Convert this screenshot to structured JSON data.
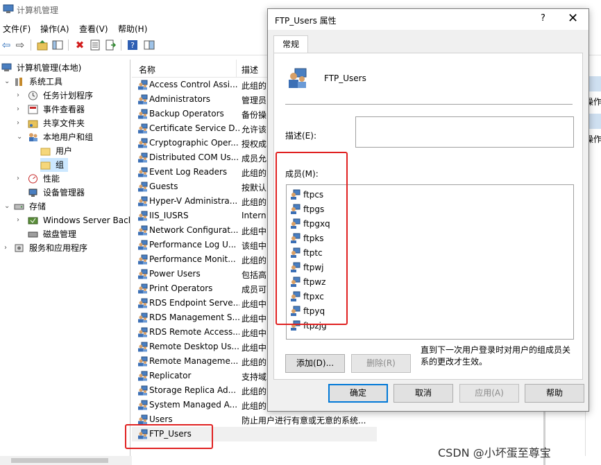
{
  "window": {
    "title": "计算机管理"
  },
  "menu": [
    "文件(F)",
    "操作(A)",
    "查看(V)",
    "帮助(H)"
  ],
  "toolbar": {
    "back_icon": "back-arrow-icon",
    "forward_icon": "forward-arrow-icon",
    "up_icon": "up-folder-icon",
    "show_tree_icon": "show-tree-icon",
    "delete_icon": "delete-icon",
    "properties_icon": "properties-icon",
    "export_icon": "export-icon",
    "help_icon": "help-icon",
    "view_icon": "view-pane-icon"
  },
  "tree": [
    {
      "label": "计算机管理(本地)"
    },
    {
      "label": "系统工具"
    },
    {
      "label": "任务计划程序"
    },
    {
      "label": "事件查看器"
    },
    {
      "label": "共享文件夹"
    },
    {
      "label": "本地用户和组"
    },
    {
      "label": "用户"
    },
    {
      "label": "组"
    },
    {
      "label": "性能"
    },
    {
      "label": "设备管理器"
    },
    {
      "label": "存储"
    },
    {
      "label": "Windows Server Back"
    },
    {
      "label": "磁盘管理"
    },
    {
      "label": "服务和应用程序"
    }
  ],
  "list": {
    "col_name": "名称",
    "col_desc": "描述",
    "rows": [
      {
        "name": "Access Control Assi...",
        "desc": "此组的"
      },
      {
        "name": "Administrators",
        "desc": "管理员"
      },
      {
        "name": "Backup Operators",
        "desc": "备份操"
      },
      {
        "name": "Certificate Service D...",
        "desc": "允许该"
      },
      {
        "name": "Cryptographic Oper...",
        "desc": "授权成"
      },
      {
        "name": "Distributed COM Us...",
        "desc": "成员允"
      },
      {
        "name": "Event Log Readers",
        "desc": "此组的"
      },
      {
        "name": "Guests",
        "desc": "按默认"
      },
      {
        "name": "Hyper-V Administra...",
        "desc": "此组的"
      },
      {
        "name": "IIS_IUSRS",
        "desc": "Intern"
      },
      {
        "name": "Network Configurat...",
        "desc": "此组中"
      },
      {
        "name": "Performance Log U...",
        "desc": "该组中"
      },
      {
        "name": "Performance Monit...",
        "desc": "此组的"
      },
      {
        "name": "Power Users",
        "desc": "包括高"
      },
      {
        "name": "Print Operators",
        "desc": "成员可"
      },
      {
        "name": "RDS Endpoint Serve...",
        "desc": "此组中"
      },
      {
        "name": "RDS Management S...",
        "desc": "此组中"
      },
      {
        "name": "RDS Remote Access...",
        "desc": "此组中"
      },
      {
        "name": "Remote Desktop Us...",
        "desc": "此组中"
      },
      {
        "name": "Remote Manageme...",
        "desc": "此组的"
      },
      {
        "name": "Replicator",
        "desc": "支持域"
      },
      {
        "name": "Storage Replica Ad...",
        "desc": "此组的"
      },
      {
        "name": "System Managed A...",
        "desc": "此组的"
      },
      {
        "name": "Users",
        "desc": "防止用户进行有意或无意的系统..."
      },
      {
        "name": "FTP_Users",
        "desc": ""
      }
    ]
  },
  "right_pane": {
    "text1": "操作",
    "text2": "操作"
  },
  "dialog": {
    "title": "FTP_Users 属性",
    "help": "?",
    "close": "✕",
    "tab": "常规",
    "group_name": "FTP_Users",
    "desc_label": "描述(E):",
    "desc_value": "",
    "members_label": "成员(M):",
    "members": [
      "ftpcs",
      "ftpgs",
      "ftpgxq",
      "ftpks",
      "ftptc",
      "ftpwj",
      "ftpwz",
      "ftpxc",
      "ftpyq",
      "ftpzjg"
    ],
    "add_btn": "添加(D)...",
    "remove_btn": "删除(R)",
    "note": "直到下一次用户登录时对用户的组成员关系的更改才生效。",
    "ok": "确定",
    "cancel": "取消",
    "apply": "应用(A)",
    "help_btn": "帮助"
  },
  "watermark": "CSDN @小坏蛋至尊宝",
  "colors": {
    "selection": "#cce8ff",
    "highlight_box": "#e02020",
    "default_button": "#0078d7"
  }
}
